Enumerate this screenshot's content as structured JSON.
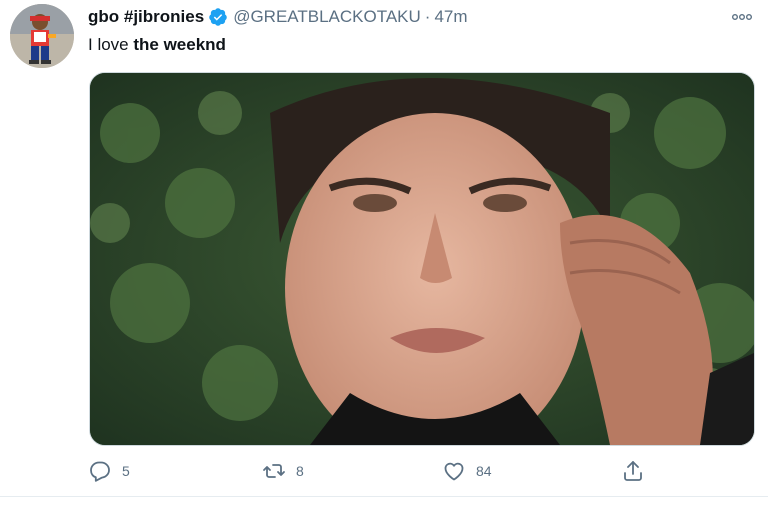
{
  "tweet": {
    "display_name": "gbo #jibronies",
    "handle": "@GREATBLACKOTAKU",
    "separator": "·",
    "timestamp": "47m",
    "text_prefix": "I love ",
    "text_bold": "the weeknd",
    "verified": true,
    "media": {
      "type": "photo"
    }
  },
  "actions": {
    "reply_count": "5",
    "retweet_count": "8",
    "like_count": "84"
  },
  "icons": {
    "verified": "verified-badge-icon",
    "more": "more-options-icon",
    "reply": "reply-icon",
    "retweet": "retweet-icon",
    "like": "heart-icon",
    "share": "share-icon"
  },
  "colors": {
    "text": "#0f1419",
    "secondary": "#5b7083",
    "verified_blue": "#1da1f2",
    "divider": "#e6ecf0"
  }
}
